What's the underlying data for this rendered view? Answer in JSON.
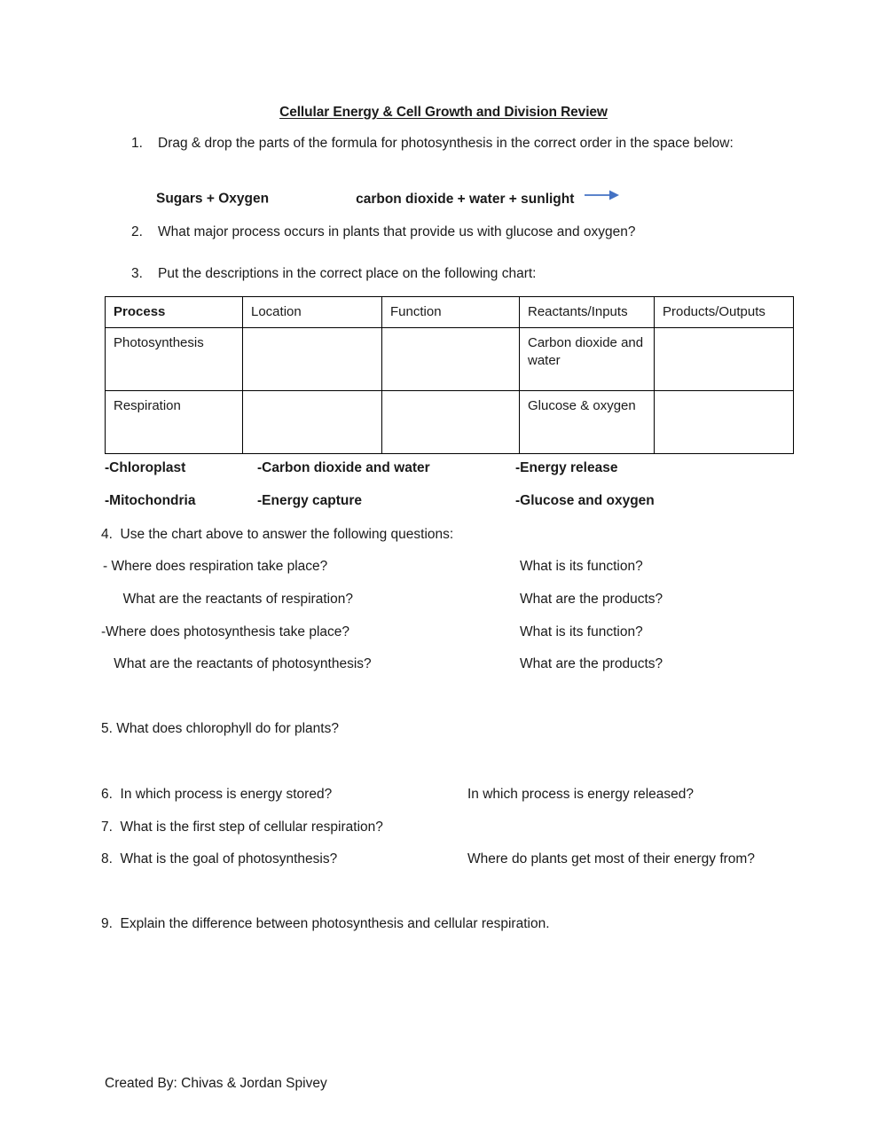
{
  "document": {
    "title": "Cellular Energy & Cell Growth and Division Review",
    "footer": "Created By: Chivas & Jordan Spivey"
  },
  "colors": {
    "text": "#1a1a1a",
    "arrow": "#4472C4",
    "table_border": "#000000",
    "page_background": "#ffffff"
  },
  "numbered_items": [
    {
      "number": "1.",
      "text": "Drag & drop the parts of the formula for photosynthesis in the correct order in the space below:"
    },
    {
      "number": "2.",
      "text": "What major process occurs in plants that provide us with glucose and oxygen?"
    },
    {
      "number": "3.",
      "text": "Put the descriptions in the correct place on the following chart:"
    }
  ],
  "formula": {
    "part1": "Sugars + Oxygen",
    "part2": "carbon dioxide + water + sunlight",
    "arrow_icon": "right-arrow-icon"
  },
  "table": {
    "headers": [
      "Process",
      "Location",
      "Function",
      "Reactants/Inputs",
      "Products/Outputs"
    ],
    "rows": [
      {
        "process": "Photosynthesis",
        "location": "",
        "function": "",
        "reactants": "Carbon dioxide and water",
        "products": ""
      },
      {
        "process": "Respiration",
        "location": "",
        "function": "",
        "reactants": "Glucose & oxygen",
        "products": ""
      }
    ]
  },
  "word_bank": {
    "row1": [
      "-Chloroplast",
      "-Carbon dioxide and water",
      "-Energy release"
    ],
    "row2": [
      "-Mitochondria",
      "-Energy capture",
      "-Glucose and oxygen"
    ]
  },
  "question4": {
    "heading": "4.  Use the chart above to answer the following questions:",
    "sub_questions": [
      {
        "left": "- Where does respiration take place?",
        "right": "What is its function?"
      },
      {
        "left": "  What are the reactants of respiration?",
        "right": "What are the products?"
      },
      {
        "left": "-Where does photosynthesis take place?",
        "right": "What is its function?"
      },
      {
        "left": " What are the reactants of photosynthesis?",
        "right": "What are the products?"
      }
    ]
  },
  "questions": {
    "q5": "5. What does chlorophyll do for plants?",
    "q6_left": "6.  In which process is energy stored?",
    "q6_right": "In which process is energy released?",
    "q7": "7.  What is the first step of cellular respiration?",
    "q8_left": "8.  What is the goal of photosynthesis?",
    "q8_right": "Where do plants get most of their energy from?",
    "q9": "9.  Explain the difference between photosynthesis and cellular respiration."
  }
}
